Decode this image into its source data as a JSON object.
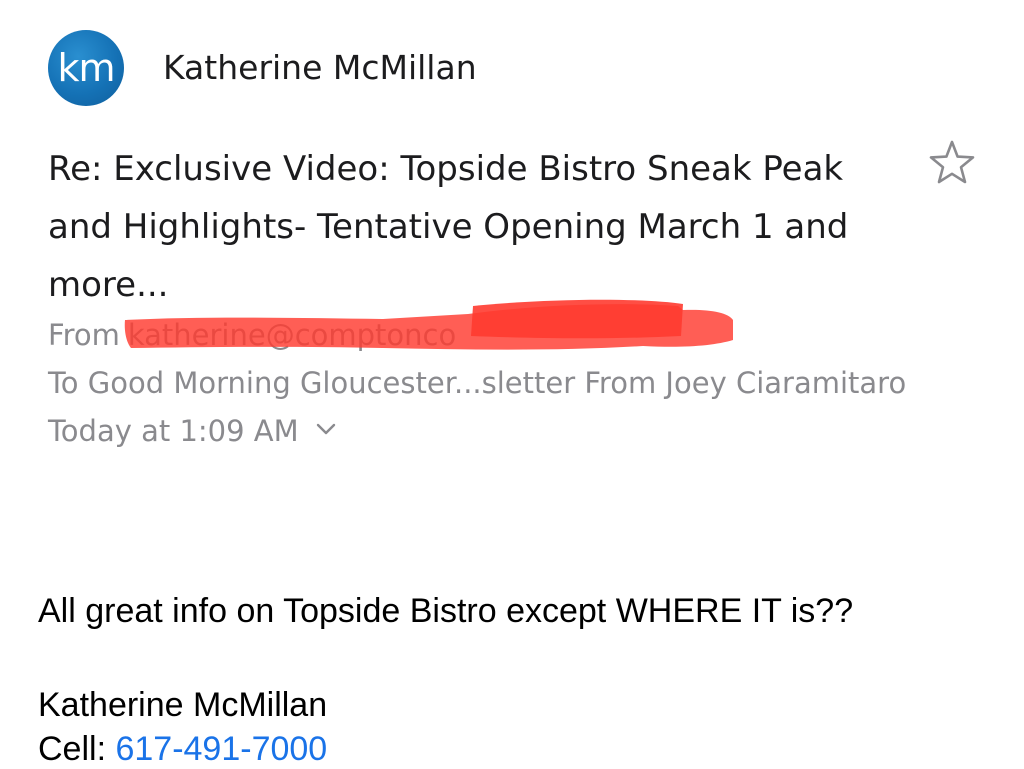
{
  "sender": {
    "avatar_initials": "km",
    "name": "Katherine McMillan"
  },
  "message": {
    "subject": "Re: Exclusive Video: Topside Bistro Sneak Peak and Highlights- Tentative Opening March 1 and more...",
    "from_label": "From",
    "from_address": "katherine@comptonco",
    "to_line": "To Good Morning Gloucester...sletter From Joey Ciaramitaro",
    "date": "Today at 1:09 AM",
    "body": "All great info on Topside Bistro except WHERE IT is??",
    "signature_name": "Katherine McMillan",
    "signature_phone_label": "Cell: ",
    "signature_phone": "617-491-7000"
  },
  "icons": {
    "star": "star-icon",
    "details": "chevron-down-icon",
    "redaction": "redaction-scribble"
  },
  "colors": {
    "avatar": "#1572b6",
    "meta_text": "#8a8a8e",
    "redaction": "#ff3b30",
    "link": "#1a73e8"
  }
}
